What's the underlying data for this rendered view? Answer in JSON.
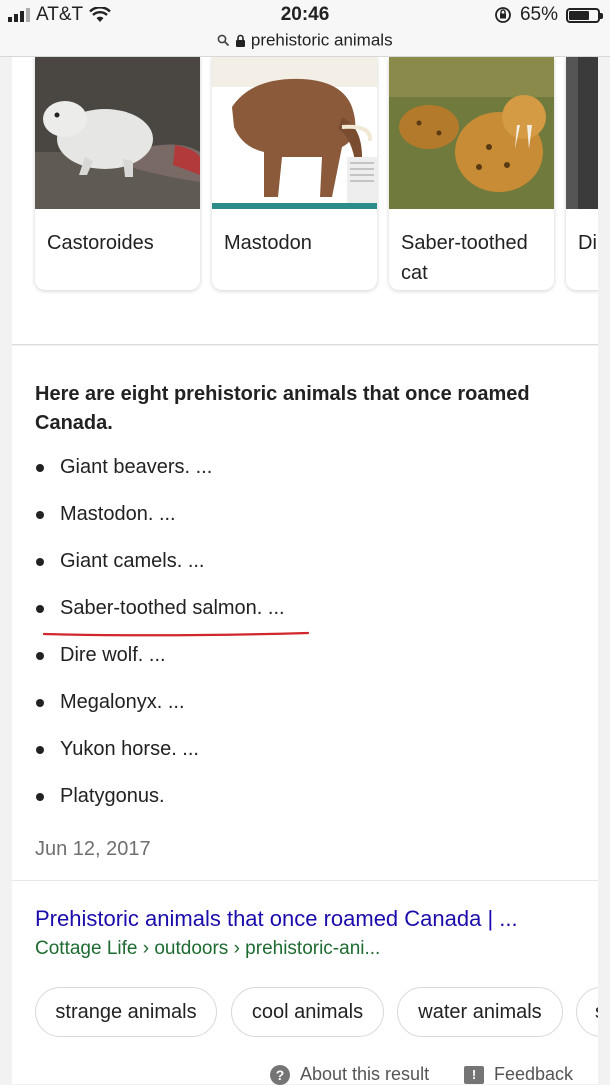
{
  "status": {
    "carrier": "AT&T",
    "time": "20:46",
    "battery": "65%",
    "url": "prehistoric animals"
  },
  "carousel": [
    {
      "label": "Castoroides"
    },
    {
      "label": "Mastodon"
    },
    {
      "label": "Saber-toothed cat"
    },
    {
      "label": "Di"
    }
  ],
  "featured": {
    "heading": "Here are eight prehistoric animals that once roamed Canada.",
    "items": [
      "Giant beavers. ...",
      "Mastodon. ...",
      "Giant camels. ...",
      "Saber-toothed salmon. ...",
      "Dire wolf. ...",
      "Megalonyx. ...",
      "Yukon horse. ...",
      "Platygonus."
    ],
    "date": "Jun 12, 2017",
    "result_title": "Prehistoric animals that once roamed Canada | ...",
    "result_url": "Cottage Life › outdoors › prehistoric-ani..."
  },
  "chips": [
    "strange animals",
    "cool animals",
    "water animals",
    "s"
  ],
  "footer": {
    "about": "About this result",
    "feedback": "Feedback"
  },
  "colors": {
    "link": "#1a0dab",
    "url_green": "#1e6b31",
    "annotation_red": "#d0262c"
  }
}
